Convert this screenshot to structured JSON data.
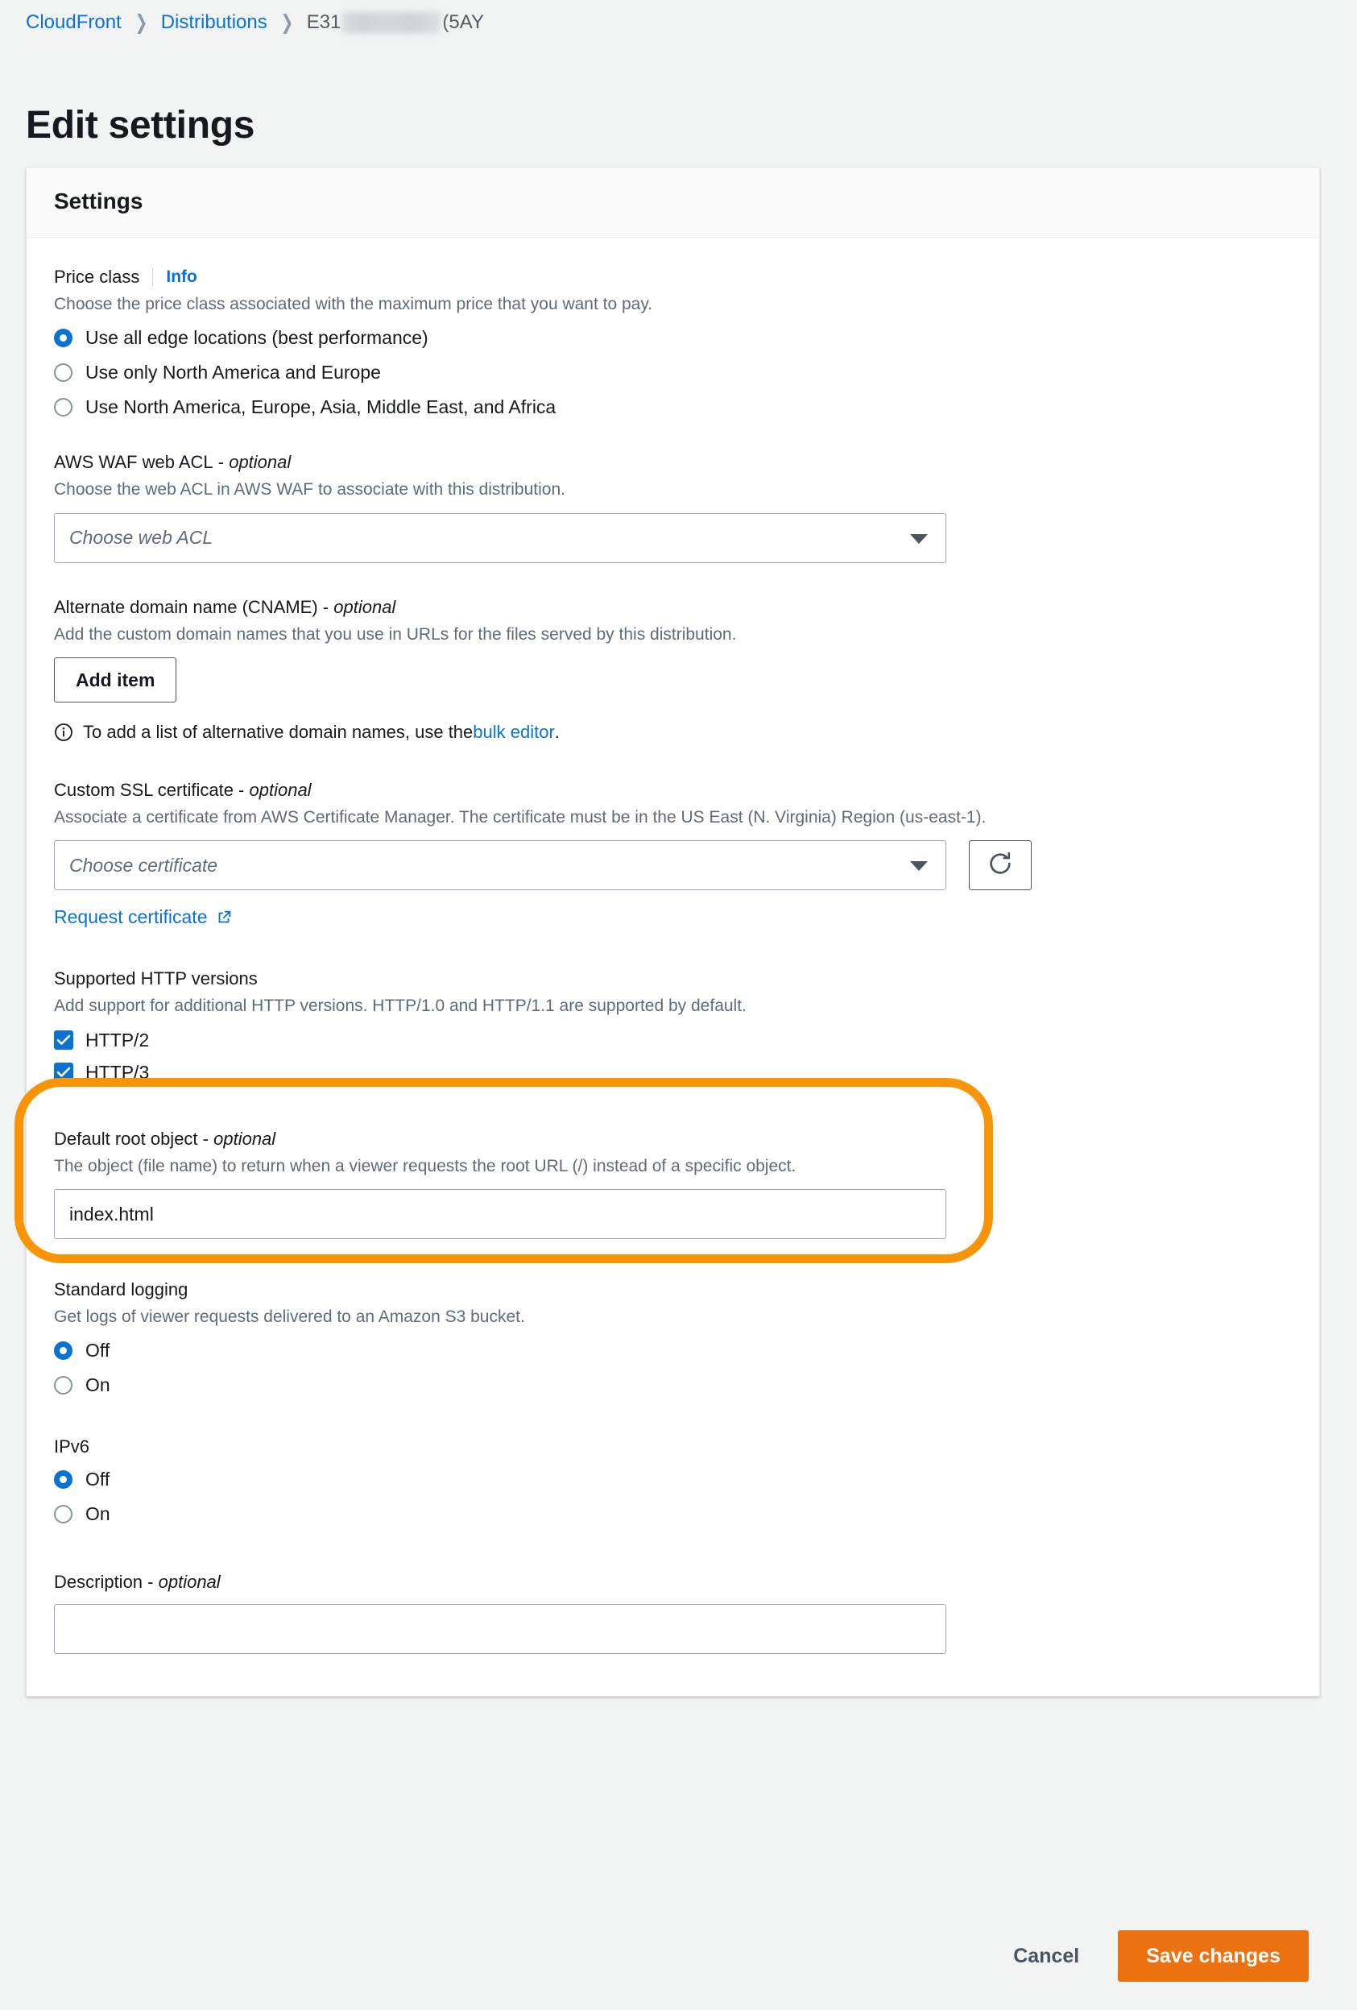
{
  "breadcrumb": {
    "items": [
      {
        "label": "CloudFront",
        "type": "link"
      },
      {
        "label": "Distributions",
        "type": "link"
      }
    ],
    "current_prefix": "E31",
    "current_suffix": "(5AY",
    "redacted": true
  },
  "page": {
    "title": "Edit settings"
  },
  "card": {
    "header_title": "Settings"
  },
  "price_class": {
    "label": "Price class",
    "info_label": "Info",
    "description": "Choose the price class associated with the maximum price that you want to pay.",
    "options": [
      {
        "label": "Use all edge locations (best performance)",
        "checked": true
      },
      {
        "label": "Use only North America and Europe",
        "checked": false
      },
      {
        "label": "Use North America, Europe, Asia, Middle East, and Africa",
        "checked": false
      }
    ]
  },
  "waf": {
    "label": "AWS WAF web ACL",
    "optional_suffix": "optional",
    "description": "Choose the web ACL in AWS WAF to associate with this distribution.",
    "select_placeholder": "Choose web ACL",
    "select_value": ""
  },
  "cname": {
    "label": "Alternate domain name (CNAME)",
    "optional_suffix": "optional",
    "description": "Add the custom domain names that you use in URLs for the files served by this distribution.",
    "add_item_label": "Add item",
    "hint_prefix": "To add a list of alternative domain names, use the ",
    "hint_link": "bulk editor",
    "hint_suffix": "."
  },
  "ssl": {
    "label": "Custom SSL certificate",
    "optional_suffix": "optional",
    "description": "Associate a certificate from AWS Certificate Manager. The certificate must be in the US East (N. Virginia) Region (us-east-1).",
    "select_placeholder": "Choose certificate",
    "select_value": "",
    "refresh_icon": "refresh-icon",
    "request_link": "Request certificate"
  },
  "http_versions": {
    "label": "Supported HTTP versions",
    "description": "Add support for additional HTTP versions. HTTP/1.0 and HTTP/1.1 are supported by default.",
    "options": [
      {
        "label": "HTTP/2",
        "checked": true
      },
      {
        "label": "HTTP/3",
        "checked": true
      }
    ],
    "highlighted": true,
    "highlight_color": "#f89406"
  },
  "default_root_object": {
    "label": "Default root object",
    "optional_suffix": "optional",
    "description": "The object (file name) to return when a viewer requests the root URL (/) instead of a specific object.",
    "value": "index.html",
    "placeholder": ""
  },
  "standard_logging": {
    "label": "Standard logging",
    "description": "Get logs of viewer requests delivered to an Amazon S3 bucket.",
    "options": [
      {
        "label": "Off",
        "checked": true
      },
      {
        "label": "On",
        "checked": false
      }
    ]
  },
  "ipv6": {
    "label": "IPv6",
    "description": "",
    "options": [
      {
        "label": "Off",
        "checked": true
      },
      {
        "label": "On",
        "checked": false
      }
    ]
  },
  "description_field": {
    "label": "Description",
    "optional_suffix": "optional",
    "value": "",
    "placeholder": ""
  },
  "footer": {
    "cancel_label": "Cancel",
    "save_label": "Save changes"
  },
  "colors": {
    "link_blue": "#0972d3",
    "accent_orange": "#ec7211",
    "highlight_orange": "#f89406",
    "page_bg": "#f2f3f3",
    "text": "#16191f",
    "muted_text": "#5f6b7a"
  }
}
